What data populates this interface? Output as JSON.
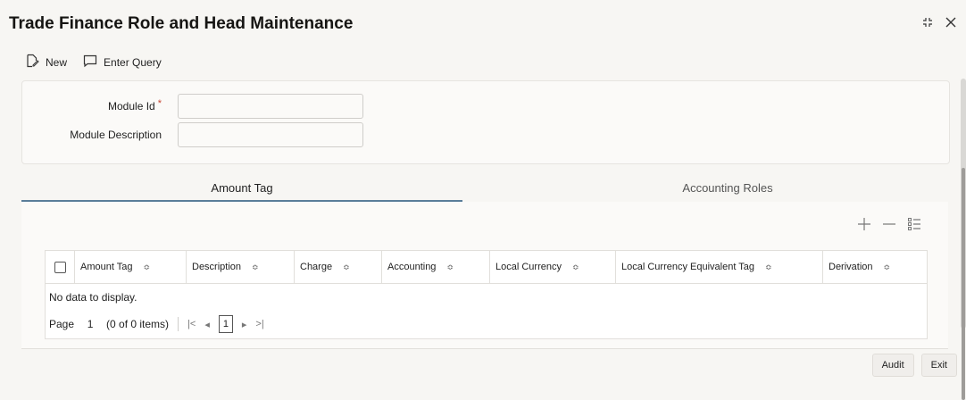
{
  "page": {
    "title": "Trade Finance Role and Head Maintenance"
  },
  "window_controls": {
    "expand_icon": "expand-icon",
    "close_icon": "close-icon"
  },
  "toolbar": {
    "new_label": "New",
    "enter_query_label": "Enter Query"
  },
  "form": {
    "module_id_label": "Module Id",
    "module_id_required": "*",
    "module_id_value": "",
    "module_description_label": "Module Description",
    "module_description_value": ""
  },
  "tabs": [
    {
      "label": "Amount Tag",
      "active": true
    },
    {
      "label": "Accounting Roles",
      "active": false
    }
  ],
  "table": {
    "columns": [
      "Amount Tag",
      "Description",
      "Charge",
      "Accounting",
      "Local Currency",
      "Local Currency Equivalent Tag",
      "Derivation"
    ],
    "sort_glyph": "≎",
    "no_data": "No data to display.",
    "pager": {
      "page_label": "Page",
      "page_value": "1",
      "items": "(0 of 0 items)",
      "first": "|<",
      "prev": "◂",
      "current": "1",
      "next": "▸",
      "last": ">|"
    }
  },
  "footer": {
    "audit_label": "Audit",
    "exit_label": "Exit"
  },
  "colors": {
    "accent": "#5a7d9a",
    "required": "#c74634",
    "background": "#f7f6f3"
  }
}
